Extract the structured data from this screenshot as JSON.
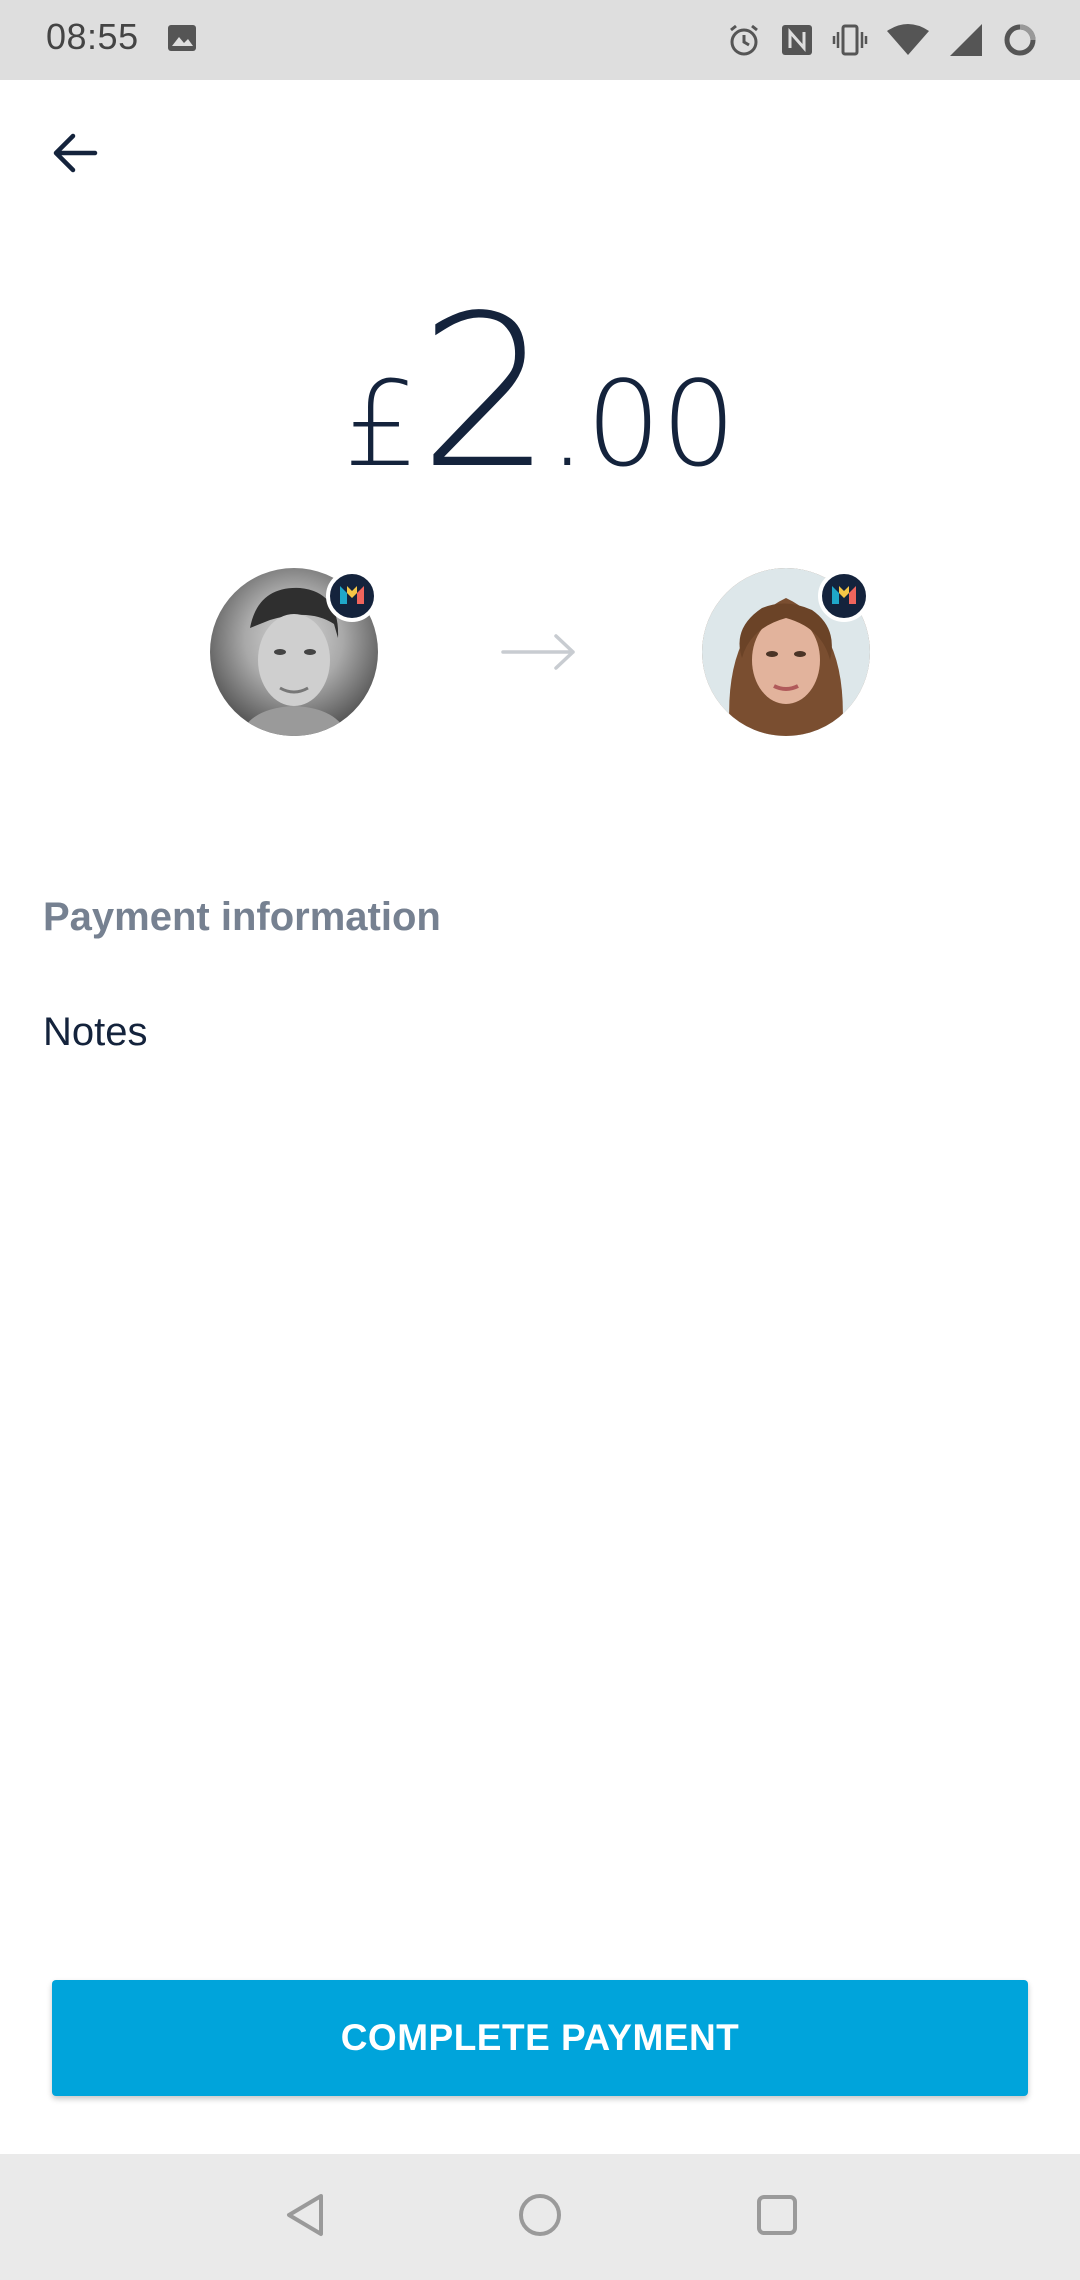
{
  "status_bar": {
    "time": "08:55",
    "icons": [
      "image-icon",
      "alarm-icon",
      "nfc-icon",
      "vibrate-icon",
      "wifi-icon",
      "signal-icon",
      "battery-icon"
    ]
  },
  "header": {
    "back_icon": "arrow-left-icon"
  },
  "payment": {
    "currency_symbol": "£",
    "amount_whole": "2",
    "amount_decimal": ".00",
    "sender_badge_icon": "monzo-icon",
    "recipient_badge_icon": "monzo-icon"
  },
  "section": {
    "title": "Payment information"
  },
  "notes": {
    "placeholder": "Notes"
  },
  "actions": {
    "complete_label": "COMPLETE PAYMENT"
  },
  "nav": {
    "back_icon": "nav-back-icon",
    "home_icon": "nav-home-icon",
    "recents_icon": "nav-recents-icon"
  },
  "colors": {
    "primary_text": "#14233c",
    "muted_text": "#768191",
    "accent": "#00a4db",
    "status_bar_bg": "#dedede",
    "nav_bar_bg": "#eaeaea"
  }
}
